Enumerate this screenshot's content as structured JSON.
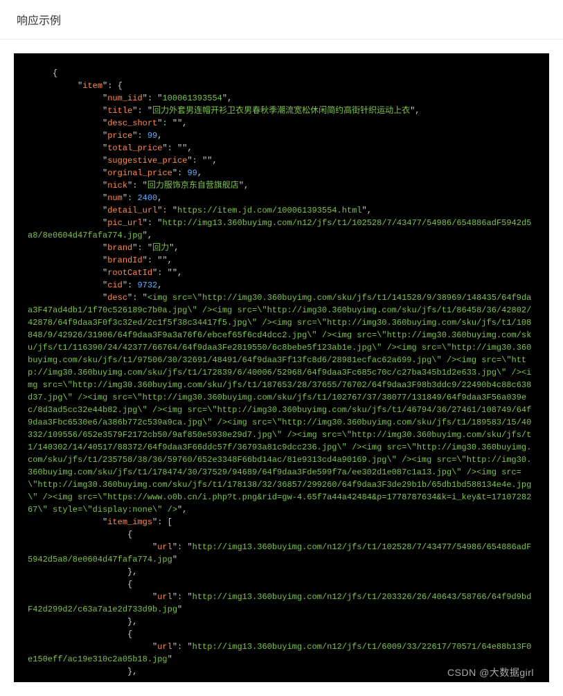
{
  "header": {
    "title": "响应示例"
  },
  "watermark": "CSDN @大数据girl",
  "code": {
    "indent": {
      "l0": "     ",
      "l1": "          ",
      "l2": "               ",
      "l3": "                    ",
      "l4": "                         "
    },
    "brace_open": "{",
    "brace_close": "}",
    "bracket_open": "[",
    "bracket_close": "]",
    "colon": ": ",
    "comma": ",",
    "quote": "\"",
    "keys": {
      "item": "item",
      "num_iid": "num_iid",
      "title": "title",
      "desc_short": "desc_short",
      "price": "price",
      "total_price": "total_price",
      "suggestive_price": "suggestive_price",
      "orginal_price": "orginal_price",
      "nick": "nick",
      "num": "num",
      "detail_url": "detail_url",
      "pic_url": "pic_url",
      "brand": "brand",
      "brandId": "brandId",
      "rootCatId": "rootCatId",
      "cid": "cid",
      "desc": "desc",
      "item_imgs": "item_imgs",
      "url": "url"
    },
    "values": {
      "num_iid": "100061393554",
      "title": "回力外套男连帽开衫卫衣男春秋季潮流宽松休闲简约高街针织运动上衣",
      "desc_short": "",
      "price": "99",
      "total_price": "",
      "suggestive_price": "",
      "orginal_price": "99",
      "nick": "回力服饰京东自营旗舰店",
      "num": "2400",
      "detail_url": "https://item.jd.com/100061393554.html",
      "pic_url": "http://img13.360buyimg.com/n12/jfs/t1/102528/7/43477/54986/654886adF5942d5a8/8e0604d47fafa774.jpg",
      "brand": "回力",
      "brandId": "",
      "rootCatId": "",
      "cid": "9732",
      "desc": "<img src=\\\"http://img30.360buyimg.com/sku/jfs/t1/141528/9/38969/148435/64f9daa3F47ad4db1/1f70c526189c7b0a.jpg\\\" /><img src=\\\"http://img30.360buyimg.com/sku/jfs/t1/86458/36/42802/42878/64f9daa3F0f3c32ed/2c1f5f38c34417f5.jpg\\\" /><img src=\\\"http://img30.360buyimg.com/sku/jfs/t1/108848/9/42926/31906/64f9daa3F9a3a76f6/ebcef65f6cd4dcc2.jpg\\\" /><img src=\\\"http://img30.360buyimg.com/sku/jfs/t1/116390/24/42377/66764/64f9daa3Fe2819550/6c8bebe5f123ab1e.jpg\\\" /><img src=\\\"http://img30.360buyimg.com/sku/jfs/t1/97506/30/32691/48491/64f9daa3Ff13fc8d6/28981ecfac62a699.jpg\\\" /><img src=\\\"http://img30.360buyimg.com/sku/jfs/t1/172839/6/40006/52968/64f9daa3Fc685c70c/c27ba345b1d2e633.jpg\\\" /><img src=\\\"http://img30.360buyimg.com/sku/jfs/t1/187653/28/37655/76702/64f9daa3F98b3ddc9/22490b4c88c638d37.jpg\\\" /><img src=\\\"http://img30.360buyimg.com/sku/jfs/t1/102767/37/38077/131849/64f9daa3F56a039ec/8d3ad5cc32e44b82.jpg\\\" /><img src=\\\"http://img30.360buyimg.com/sku/jfs/t1/46794/36/27461/108749/64f9daa3Fbc6530e6/a386b772c539a9ca.jpg\\\" /><img src=\\\"http://img30.360buyimg.com/sku/jfs/t1/189583/15/40332/109556/652e3579F2172cb50/9af850e5930e29d7.jpg\\\" /><img src=\\\"http://img30.360buyimg.com/sku/jfs/t1/140302/14/40517/88372/64f9daa3F66ddc57f/36793a81c9dcc236.jpg\\\" /><img src=\\\"http://img30.360buyimg.com/sku/jfs/t1/235758/38/36/59760/652e3348F66bd14ac/81e9313cd4a90169.jpg\\\" /><img src=\\\"http://img30.360buyimg.com/sku/jfs/t1/178474/30/37529/94689/64f9daa3Fde599f7a/ee302d1e087c1a13.jpg\\\" /><img src=\\\"http://img30.360buyimg.com/sku/jfs/t1/178138/32/36857/299260/64f9daa3F3de29b1b/65db1bd588134e4e.jpg\\\" /><img src=\\\"https://www.o0b.cn/i.php?t.png&rid=gw-4.65f7a44a42484&p=1778787634&k=i_key&t=1710728267\\\" style=\\\"display:none\\\" />",
      "url1": "http://img13.360buyimg.com/n12/jfs/t1/102528/7/43477/54986/654886adF5942d5a8/8e0604d47fafa774.jpg",
      "url2": "http://img13.360buyimg.com/n12/jfs/t1/203326/26/40643/58766/64f9d9bdF42d299d2/c63a7a1e2d733d9b.jpg",
      "url3": "http://img13.360buyimg.com/n12/jfs/t1/6009/33/22617/70571/64e88b13F0e150eff/ac19e310c2a05b18.jpg"
    }
  }
}
